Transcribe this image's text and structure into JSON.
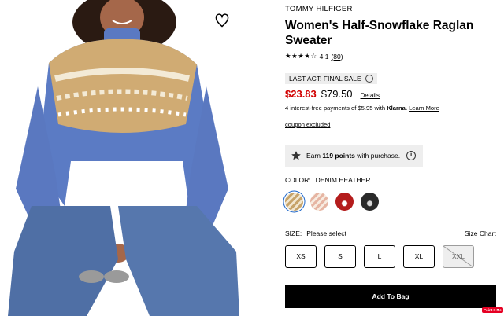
{
  "product": {
    "brand": "TOMMY HILFIGER",
    "title": "Women's Half-Snowflake Raglan Sweater",
    "rating_stars": "★★★★☆",
    "rating_value": "4.1",
    "review_count": "(80)",
    "badge_text": "LAST ACT: FINAL SALE",
    "sale_price": "$23.83",
    "original_price": "$79.50",
    "details_link": "Details",
    "installments": {
      "prefix": "4 interest-free payments of $5.95 with",
      "provider": "Klarna.",
      "link": "Learn More"
    },
    "coupon_text": "coupon excluded",
    "points": {
      "prefix": "Earn",
      "amount": "119 points",
      "suffix": "with purchase."
    },
    "color": {
      "label": "COLOR:",
      "selected": "DENIM HEATHER",
      "swatch_count": 4,
      "accent": "#1a64c8"
    },
    "size": {
      "label": "SIZE:",
      "prompt": "Please select",
      "chart_link": "Size Chart",
      "options": [
        "XS",
        "S",
        "L",
        "XL",
        "XXL"
      ],
      "unavailable": [
        "XXL"
      ]
    },
    "add_to_bag": "Add To Bag",
    "pin_badge": "Point It Me"
  },
  "colors": {
    "sale_red": "#d10000",
    "button_bg": "#000000",
    "badge_bg": "#ededed",
    "points_bg": "#eeeeee"
  },
  "icons": [
    "heart-icon",
    "star-icon",
    "info-icon"
  ]
}
